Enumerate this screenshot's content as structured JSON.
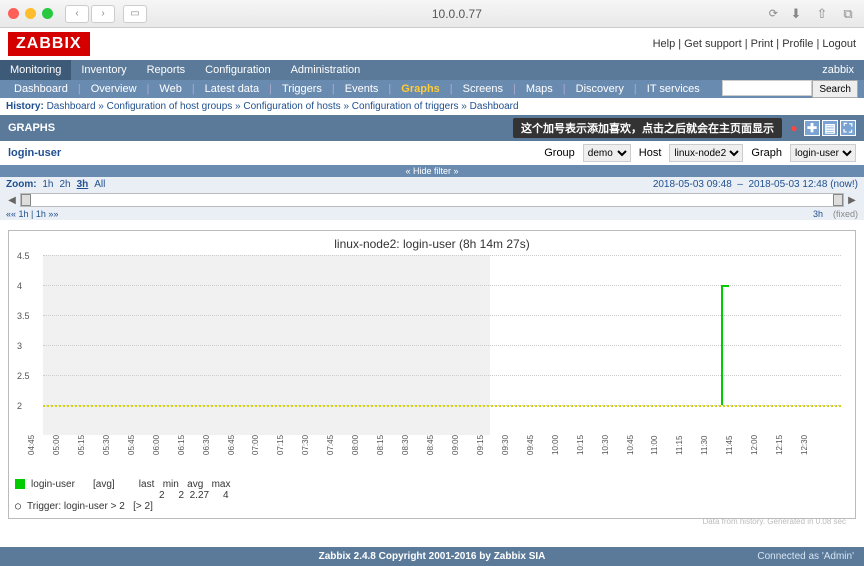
{
  "browser": {
    "url": "10.0.0.77"
  },
  "header": {
    "logo": "ZABBIX",
    "links": "Help | Get support | Print | Profile | Logout",
    "user": "zabbix"
  },
  "menu1": [
    "Monitoring",
    "Inventory",
    "Reports",
    "Configuration",
    "Administration"
  ],
  "menu2": [
    "Dashboard",
    "Overview",
    "Web",
    "Latest data",
    "Triggers",
    "Events",
    "Graphs",
    "Screens",
    "Maps",
    "Discovery",
    "IT services"
  ],
  "search": {
    "btn": "Search"
  },
  "history": {
    "label": "History:",
    "items": [
      "Dashboard",
      "Configuration of host groups",
      "Configuration of hosts",
      "Configuration of triggers",
      "Dashboard"
    ]
  },
  "graphs": {
    "title": "GRAPHS",
    "tooltip": "这个加号表示添加喜欢，点击之后就会在主页面显示"
  },
  "filter": {
    "title": "login-user",
    "group_lbl": "Group",
    "group": "demo",
    "groups": [
      "demo"
    ],
    "host_lbl": "Host",
    "host": "linux-node2",
    "hosts": [
      "linux-node2"
    ],
    "graph_lbl": "Graph",
    "graph": "login-user",
    "graphs": [
      "login-user"
    ],
    "hide": "« Hide filter »"
  },
  "zoom": {
    "label": "Zoom:",
    "opts": [
      "1h",
      "2h",
      "3h",
      "All"
    ],
    "sel": "3h",
    "range_from": "2018-05-03 09:48",
    "range_to": "2018-05-03 12:48 (now!)"
  },
  "navrow": {
    "left": "««  1h | 1h  »»",
    "right_dur": "3h",
    "right_fixed": "(fixed)"
  },
  "chart_data": {
    "type": "line",
    "title": "linux-node2: login-user (8h 14m 27s)",
    "ylabel": "",
    "ylim": [
      1.5,
      4.5
    ],
    "yticks": [
      2.0,
      2.5,
      3.0,
      3.5,
      4.0,
      4.5
    ],
    "x_start": "03.05 04:34",
    "x_end": "03.05 12:48",
    "xticks": [
      "04:45",
      "05:00",
      "05:15",
      "05:30",
      "05:45",
      "06:00",
      "06:15",
      "06:30",
      "06:45",
      "07:00",
      "07:15",
      "07:30",
      "07:45",
      "08:00",
      "08:15",
      "08:30",
      "08:45",
      "09:00",
      "09:15",
      "09:30",
      "09:45",
      "10:00",
      "10:15",
      "10:30",
      "10:45",
      "11:00",
      "11:15",
      "11:30",
      "11:45",
      "12:00",
      "12:15",
      "12:30"
    ],
    "shaded_until": "09:00",
    "trigger": {
      "name": "login-user > 2",
      "value": 2
    },
    "series": [
      {
        "name": "login-user",
        "agg": "[avg]",
        "color": "#00cc00",
        "last": 2,
        "min": 2,
        "avg": 2.27,
        "max": 4,
        "points": [
          {
            "x": "11:30",
            "y": 4
          },
          {
            "x": "11:36",
            "y": 4
          },
          {
            "x": "11:37",
            "y": 2
          }
        ]
      }
    ],
    "footer": "Data from history. Generated in 0.08 sec"
  },
  "legend": {
    "row1_label": "login-user",
    "row1_agg": "[avg]",
    "cols": "last   min   avg   max",
    "vals": "  2     2  2.27     4",
    "row2": "Trigger: login-user > 2   [> 2]"
  },
  "footer": {
    "copyright": "Zabbix 2.4.8 Copyright 2001-2016 by Zabbix SIA",
    "connected": "Connected as 'Admin'"
  }
}
